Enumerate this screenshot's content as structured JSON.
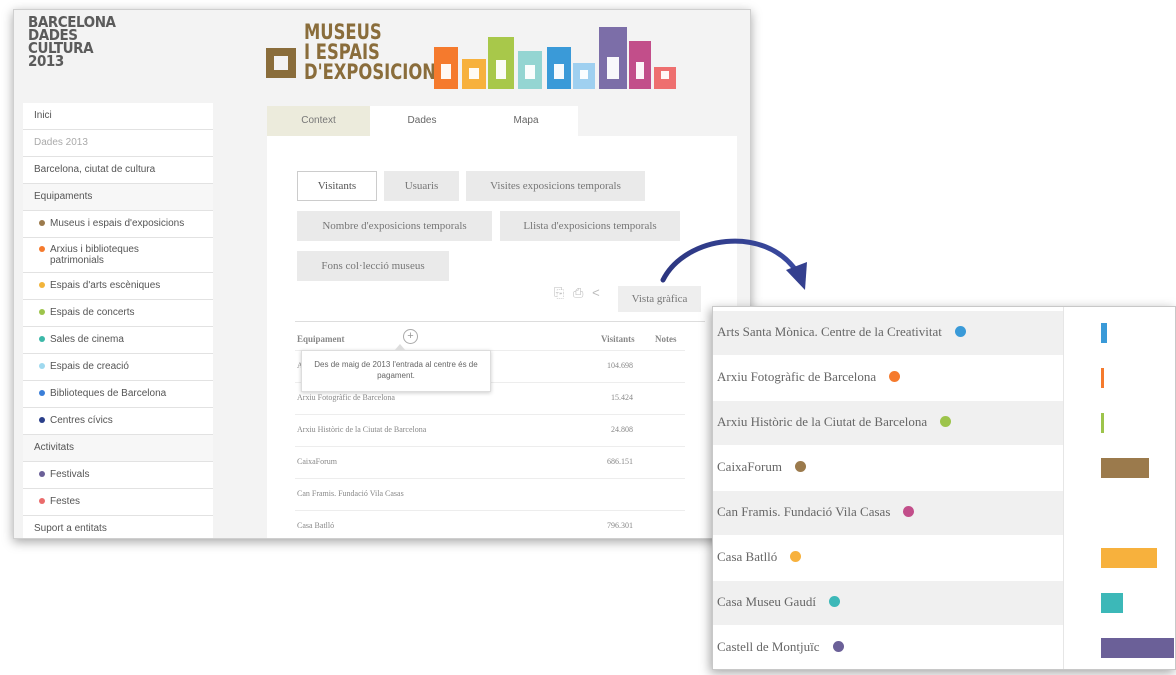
{
  "brand": {
    "lines": [
      "BARCELONA",
      "DADES",
      "CULTURA",
      "2013"
    ]
  },
  "logo": {
    "lines": [
      "MUSEUS",
      "I ESPAIS",
      "D'EXPOSICIONS"
    ],
    "bar_colors": [
      "#f57a2d",
      "#f7b13d",
      "#a8c84a",
      "#94d5d2",
      "#3a9ad8",
      "#9fd0f0",
      "#7c6ea8",
      "#c24e8a",
      "#ee6f6f"
    ]
  },
  "sidebar": {
    "items": [
      {
        "label": "Inici",
        "kind": "link"
      },
      {
        "label": "Dades 2013",
        "kind": "muted"
      },
      {
        "label": "Barcelona, ciutat de cultura",
        "kind": "link"
      },
      {
        "label": "Equipaments",
        "kind": "section"
      },
      {
        "label": "Museus i espais d'exposicions",
        "kind": "sub",
        "color": "#9b7a4c"
      },
      {
        "label": "Arxius i biblioteques patrimonials",
        "kind": "sub",
        "color": "#f57a2d"
      },
      {
        "label": "Espais d'arts escèniques",
        "kind": "sub",
        "color": "#f2b43a"
      },
      {
        "label": "Espais de concerts",
        "kind": "sub",
        "color": "#9dc44b"
      },
      {
        "label": "Sales de cinema",
        "kind": "sub",
        "color": "#3cb8a8"
      },
      {
        "label": "Espais de creació",
        "kind": "sub",
        "color": "#9fd9ef"
      },
      {
        "label": "Biblioteques de Barcelona",
        "kind": "sub",
        "color": "#3a7ed8"
      },
      {
        "label": "Centres cívics",
        "kind": "sub",
        "color": "#2a3f8a"
      },
      {
        "label": "Activitats",
        "kind": "section"
      },
      {
        "label": "Festivals",
        "kind": "sub",
        "color": "#6b6098"
      },
      {
        "label": "Festes",
        "kind": "sub",
        "color": "#ea6b6b"
      },
      {
        "label": "Suport a entitats",
        "kind": "link"
      }
    ]
  },
  "tabs": {
    "context": "Context",
    "dades": "Dades",
    "mapa": "Mapa"
  },
  "filters": {
    "visitants": "Visitants",
    "usuaris": "Usuaris",
    "visites_temporals": "Visites exposicions temporals",
    "nombre_temporals": "Nombre d'exposicions temporals",
    "llista_temporals": "Llista d'exposicions temporals",
    "fons": "Fons col·lecció museus"
  },
  "toolbar": {
    "vista_grafica": "Vista gràfica"
  },
  "table": {
    "headers": {
      "equipament": "Equipament",
      "visitants": "Visitants",
      "notes": "Notes"
    },
    "rows": [
      {
        "name": "Arts Santa Mònica. Centre de la Creativitat",
        "value": "104.698"
      },
      {
        "name": "Arxiu Fotogràfic de Barcelona",
        "value": "15.424"
      },
      {
        "name": "Arxiu Històric de la Ciutat de Barcelona",
        "value": "24.808"
      },
      {
        "name": "CaixaForum",
        "value": "686.151"
      },
      {
        "name": "Can Framis. Fundació Vila Casas",
        "value": ""
      },
      {
        "name": "Casa Batlló",
        "value": "796.301"
      }
    ],
    "tooltip": "Des de maig de 2013 l'entrada al centre és de pagament."
  },
  "zoom": {
    "rows": [
      {
        "name": "Arts Santa Mònica. Centre de la Creativitat",
        "dot": "#3a9ad8",
        "bar": "#3a9ad8",
        "level": 0.04
      },
      {
        "name": "Arxiu Fotogràfic de Barcelona",
        "dot": "#f57a2d",
        "bar": "#f57a2d",
        "level": 0.01
      },
      {
        "name": "Arxiu Històric de la Ciutat de Barcelona",
        "dot": "#9dc44b",
        "bar": "#9dc44b",
        "level": 0.01
      },
      {
        "name": "CaixaForum",
        "dot": "#9b7a4c",
        "bar": "#9b7a4c",
        "level": 0.34
      },
      {
        "name": "Can Framis. Fundació Vila Casas",
        "dot": "#c24e8a",
        "bar": "#c24e8a",
        "level": 0
      },
      {
        "name": "Casa Batlló",
        "dot": "#f7b13d",
        "bar": "#f7b13d",
        "level": 0.4
      },
      {
        "name": "Casa Museu Gaudí",
        "dot": "#3cb8b8",
        "bar": "#3cb8b8",
        "level": 0.16
      },
      {
        "name": "Castell de Montjuïc",
        "dot": "#6b6098",
        "bar": "#6b6098",
        "level": 0.52
      }
    ]
  }
}
